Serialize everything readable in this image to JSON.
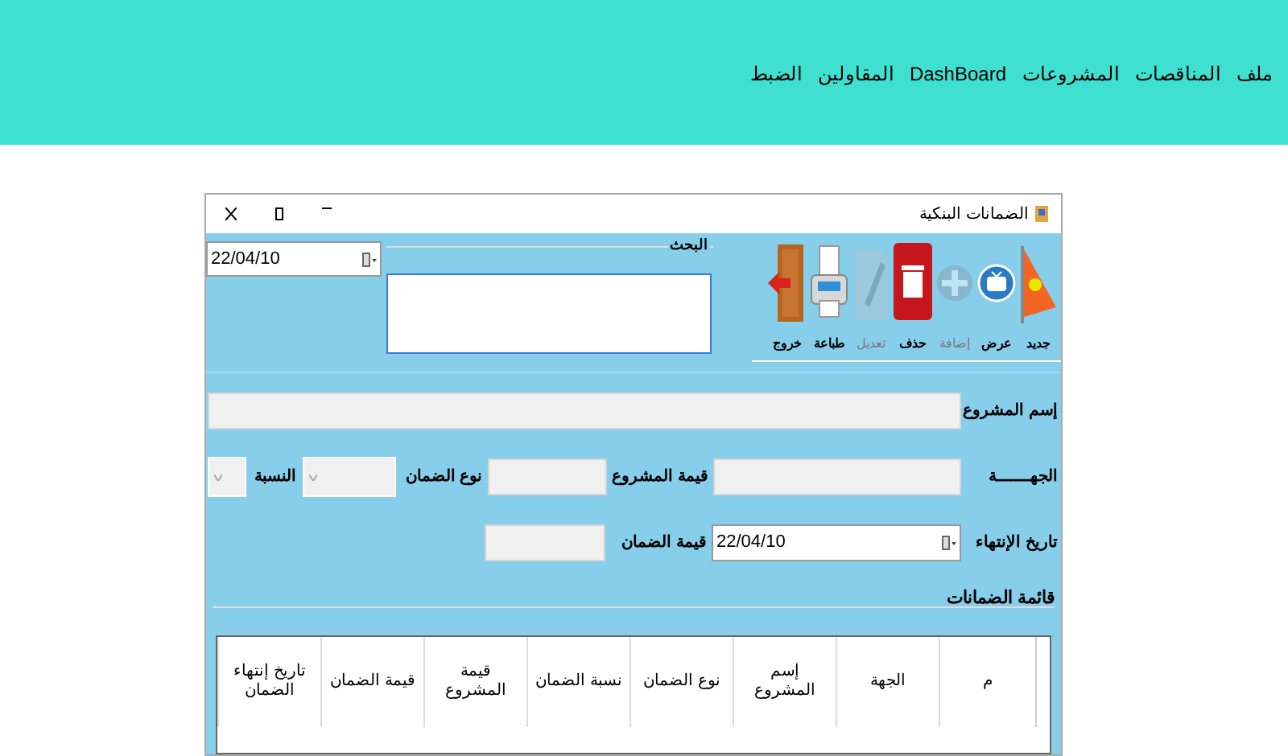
{
  "menu": [
    "ملف",
    "المناقصات",
    "المشروعات",
    "DashBoard",
    "المقاولين",
    "الضبط"
  ],
  "window": {
    "title": "الضمانات البنكية"
  },
  "toolbar": [
    {
      "label": "جديد",
      "kind": "new",
      "disabled": false
    },
    {
      "label": "عرض",
      "kind": "view",
      "disabled": false
    },
    {
      "label": "إضافة",
      "kind": "add",
      "disabled": true
    },
    {
      "label": "حذف",
      "kind": "delete",
      "disabled": false
    },
    {
      "label": "تعديل",
      "kind": "edit",
      "disabled": true
    },
    {
      "label": "طباعة",
      "kind": "print",
      "disabled": false
    },
    {
      "label": "خروج",
      "kind": "exit",
      "disabled": false
    }
  ],
  "search": {
    "legend": "البحث"
  },
  "top_date": {
    "value": "22/04/10"
  },
  "form": {
    "project_name_label": "إسم المشروع",
    "entity_label": "الجهـــــــة",
    "project_value_label": "قيمة المشروع",
    "guarantee_type_label": "نوع الضمان",
    "ratio_label": "النسبة",
    "end_date_label": "تاريخ الإنتهاء",
    "end_date_value": "22/04/10",
    "guarantee_value_label": "قيمة الضمان"
  },
  "list": {
    "title": "قائمة الضمانات",
    "columns": [
      "م",
      "الجهة",
      "إسم المشروع",
      "نوع الضمان",
      "نسبة الضمان",
      "قيمة المشروع",
      "قيمة الضمان",
      "تاريخ إنتهاء الضمان"
    ]
  }
}
